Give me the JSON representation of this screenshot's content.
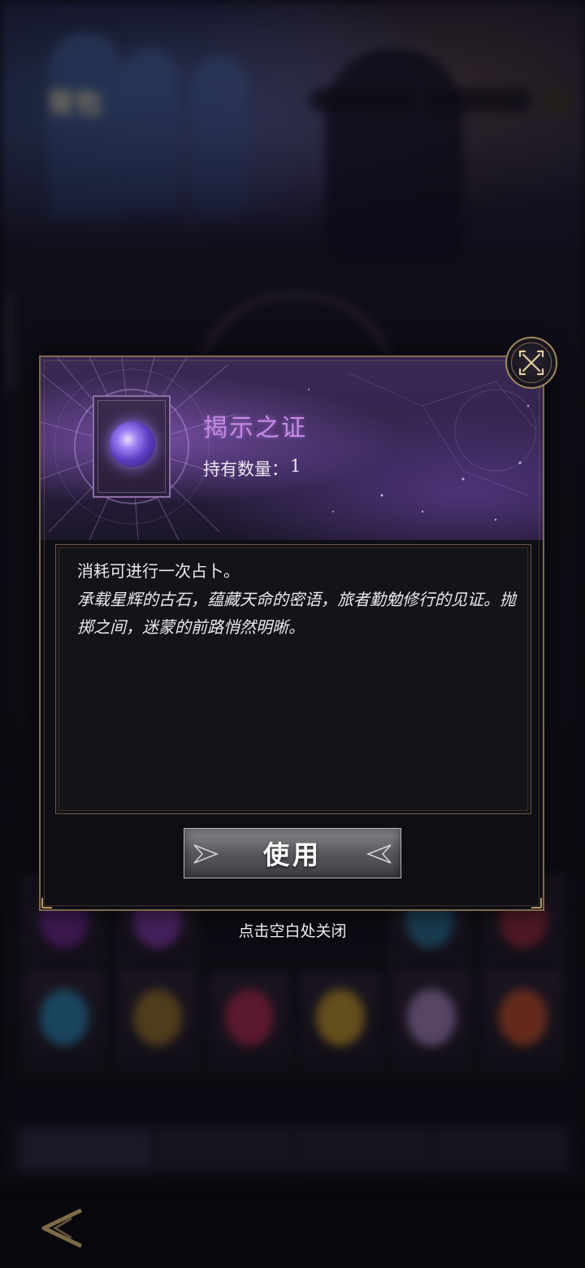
{
  "background": {
    "hud_label": "背包"
  },
  "dialog": {
    "item_name": "揭示之证",
    "quantity_label": "持有数量：",
    "quantity_value": "1",
    "effect_text": "消耗可进行一次占卜。",
    "flavor_text": "承载星辉的古石，蕴藏天命的密语，旅者勤勉修行的见证。抛掷之间，迷蒙的前路悄然明晰。",
    "use_button_label": "使用",
    "item_icon": "crystal-orb-icon",
    "close_icon": "close-x-icon"
  },
  "hint": "点击空白处关闭",
  "colors": {
    "item_name": "#c58ae6",
    "frame_gold": "#7d6a4a",
    "header_purple": "#2c2145"
  }
}
